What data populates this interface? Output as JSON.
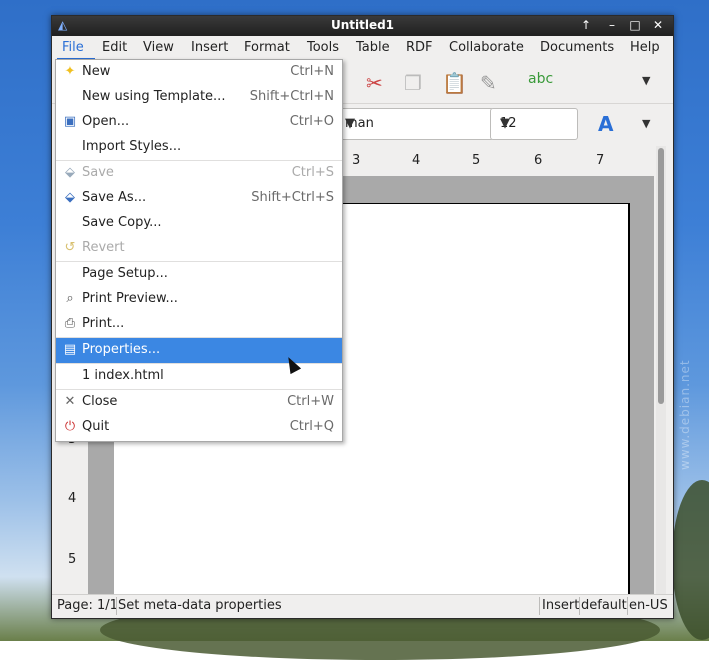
{
  "desktop": {
    "watermark": "www.debian.net"
  },
  "window": {
    "title": "Untitled1",
    "controls": {
      "up": "↑",
      "minimize": "–",
      "maximize": "□",
      "close": "✕"
    }
  },
  "menubar": [
    {
      "label": "File"
    },
    {
      "label": "Edit"
    },
    {
      "label": "View"
    },
    {
      "label": "Insert"
    },
    {
      "label": "Format"
    },
    {
      "label": "Tools"
    },
    {
      "label": "Table"
    },
    {
      "label": "RDF"
    },
    {
      "label": "Collaborate"
    },
    {
      "label": "Documents"
    },
    {
      "label": "Help"
    }
  ],
  "toolbar": {
    "font_name": "man",
    "font_size": "12"
  },
  "ruler": {
    "marks": [
      "3",
      "4",
      "5",
      "6",
      "7"
    ]
  },
  "vruler": {
    "marks": [
      "3",
      "4",
      "5"
    ]
  },
  "file_menu": {
    "items": [
      {
        "label": "New",
        "accel": "Ctrl+N",
        "icon": "new-document-icon"
      },
      {
        "label": "New using Template...",
        "accel": "Shift+Ctrl+N"
      },
      {
        "label": "Open...",
        "accel": "Ctrl+O",
        "icon": "open-folder-icon"
      },
      {
        "label": "Import Styles...",
        "accel": ""
      },
      {
        "label": "Save",
        "accel": "Ctrl+S",
        "icon": "save-icon"
      },
      {
        "label": "Save As...",
        "accel": "Shift+Ctrl+S",
        "icon": "save-as-icon"
      },
      {
        "label": "Save Copy...",
        "accel": ""
      },
      {
        "label": "Revert",
        "accel": "",
        "icon": "revert-icon"
      },
      {
        "label": "Page Setup...",
        "accel": ""
      },
      {
        "label": "Print Preview...",
        "accel": "",
        "icon": "print-preview-icon"
      },
      {
        "label": "Print...",
        "accel": "",
        "icon": "print-icon"
      },
      {
        "label": "Properties...",
        "accel": "",
        "icon": "properties-icon"
      },
      {
        "label": "1 index.html",
        "accel": ""
      },
      {
        "label": "Close",
        "accel": "Ctrl+W",
        "icon": "close-icon"
      },
      {
        "label": "Quit",
        "accel": "Ctrl+Q",
        "icon": "quit-icon"
      }
    ]
  },
  "statusbar": {
    "page": "Page: 1/1",
    "message": "Set meta-data properties",
    "mode": "Insert",
    "style": "default",
    "lang": "en-US"
  },
  "colors": {
    "accent": "#3b87e3",
    "menu_active": "#2a6fd6"
  }
}
